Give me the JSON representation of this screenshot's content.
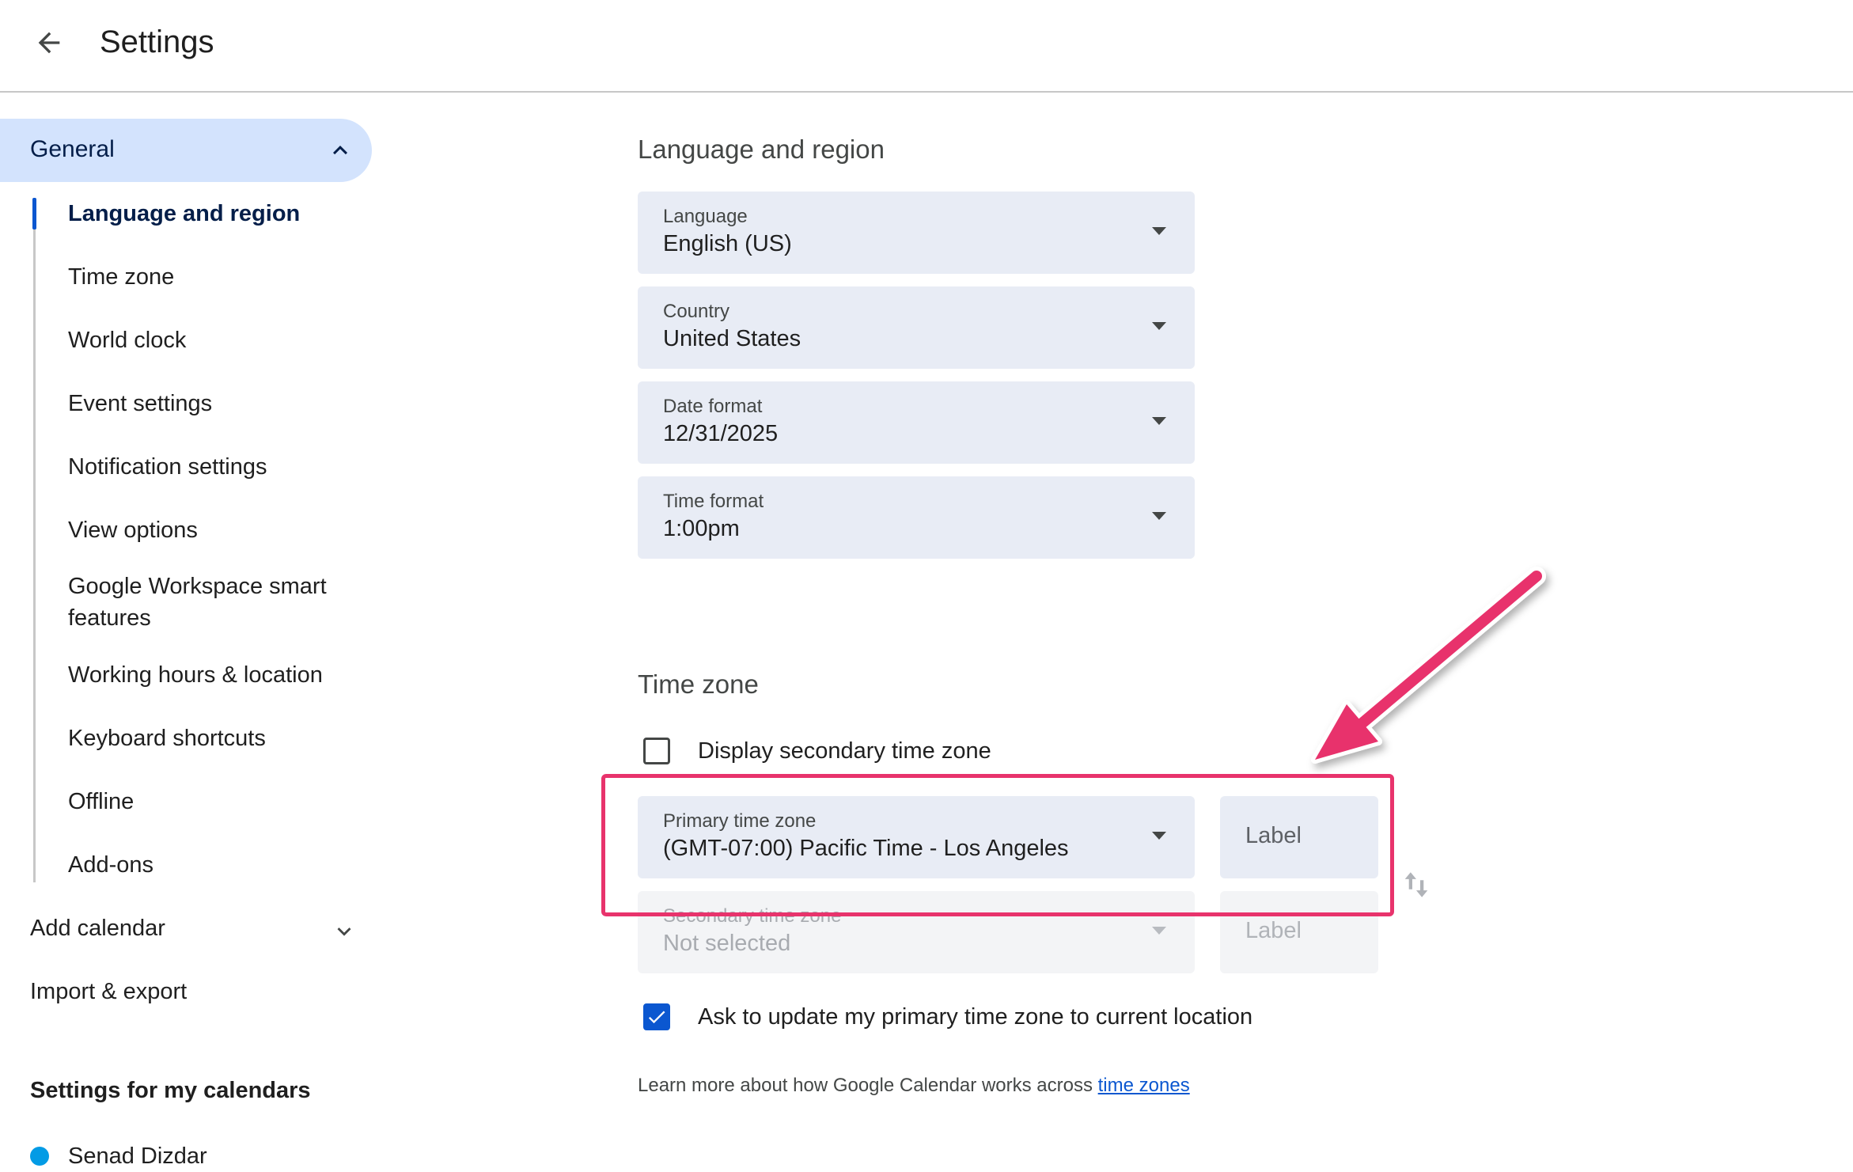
{
  "header": {
    "title": "Settings",
    "back_icon": "arrow-left-icon"
  },
  "sidebar": {
    "general_label": "General",
    "general_items": [
      "Language and region",
      "Time zone",
      "World clock",
      "Event settings",
      "Notification settings",
      "View options",
      "Google Workspace smart features",
      "Working hours & location",
      "Keyboard shortcuts",
      "Offline",
      "Add-ons"
    ],
    "add_calendar": "Add calendar",
    "import_export": "Import & export",
    "my_calendars_heading": "Settings for my calendars",
    "my_calendars": [
      {
        "name": "Senad Dizdar",
        "color": "#039be5"
      }
    ]
  },
  "language_region": {
    "title": "Language and region",
    "fields": [
      {
        "label": "Language",
        "value": "English (US)"
      },
      {
        "label": "Country",
        "value": "United States"
      },
      {
        "label": "Date format",
        "value": "12/31/2025"
      },
      {
        "label": "Time format",
        "value": "1:00pm"
      }
    ]
  },
  "time_zone": {
    "title": "Time zone",
    "display_secondary": {
      "label": "Display secondary time zone",
      "checked": false
    },
    "primary": {
      "label": "Primary time zone",
      "value": "(GMT-07:00) Pacific Time - Los Angeles",
      "label_placeholder": "Label"
    },
    "secondary": {
      "label": "Secondary time zone",
      "value": "Not selected",
      "label_placeholder": "Label",
      "disabled": true
    },
    "ask_update": {
      "label": "Ask to update my primary time zone to current location",
      "checked": true
    },
    "learn_more_text": "Learn more about how Google Calendar works across ",
    "learn_more_link": "time zones"
  },
  "colors": {
    "accent": "#0b57d0",
    "nav_active_bg": "#d3e3fd",
    "highlight": "#e8336c"
  }
}
